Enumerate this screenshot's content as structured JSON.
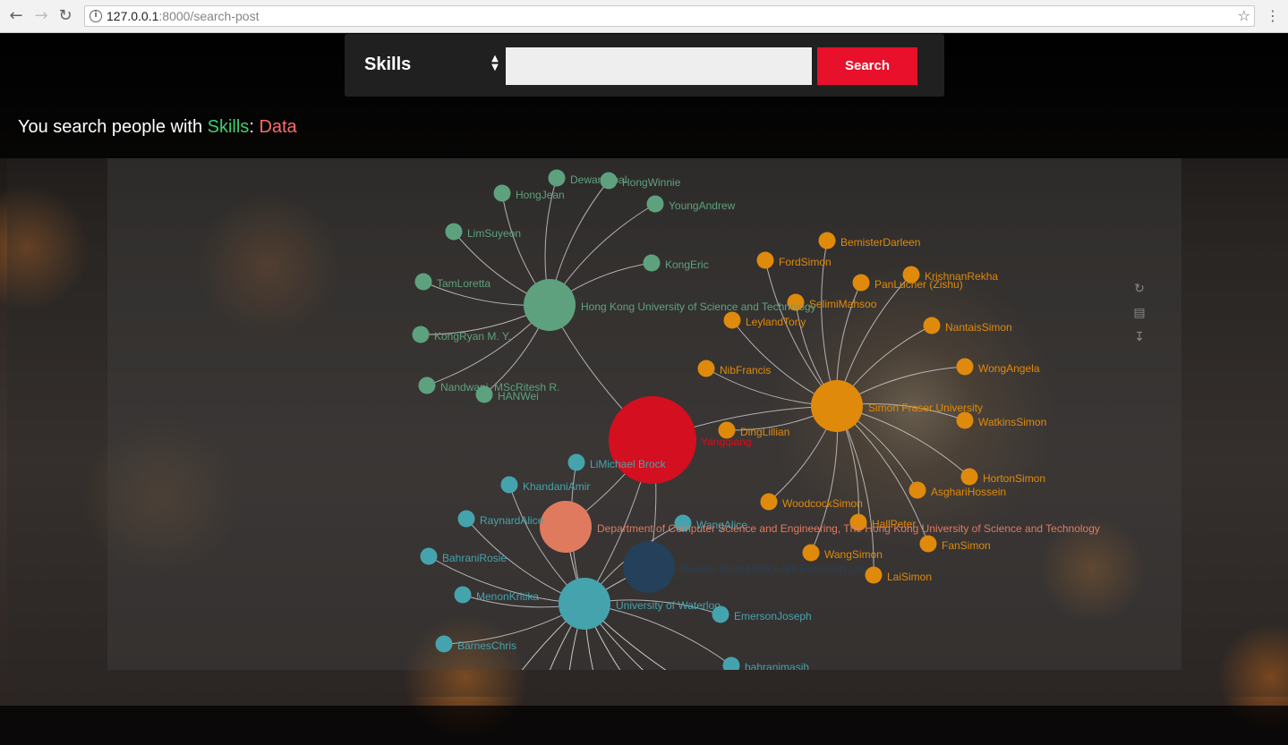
{
  "browser": {
    "url_host": "127.0.0.1",
    "url_rest": ":8000/search-post",
    "back_icon": "arrow-left-icon",
    "forward_icon": "arrow-right-icon",
    "reload_icon": "reload-icon"
  },
  "search": {
    "field_label": "Skills",
    "input_value": "",
    "button_label": "Search"
  },
  "result": {
    "prefix": "You search people with ",
    "keyword": "Skills",
    "separator": ": ",
    "value": "Data"
  },
  "colors": {
    "hkust": "#5ea17f",
    "sfu": "#e08a0b",
    "waterloo": "#45a3ad",
    "center": "#d40f1f",
    "dept": "#e07a5f",
    "huawei": "#25405a",
    "link": "#c9c9c9"
  },
  "graph": {
    "hubs": [
      {
        "id": "hkust",
        "label": "Hong Kong University of Science and Technology",
        "group": "hkust"
      },
      {
        "id": "sfu",
        "label": "Simon Fraser University",
        "group": "sfu"
      },
      {
        "id": "waterloo",
        "label": "University of Waterloo",
        "group": "waterloo"
      },
      {
        "id": "center",
        "label": "Yangqiang",
        "group": "center"
      },
      {
        "id": "dept",
        "label": "Department of Computer Science and Engineering, The Hong Kong University of Science and Technology",
        "group": "dept"
      },
      {
        "id": "huawei",
        "label": "Huawei Noah&#39;s Ark Research Lab",
        "group": "huawei"
      }
    ],
    "people": [
      {
        "label": "DewanIqbal",
        "hub": "hkust"
      },
      {
        "label": "HongWinnie",
        "hub": "hkust"
      },
      {
        "label": "HongJean",
        "hub": "hkust"
      },
      {
        "label": "YoungAndrew",
        "hub": "hkust"
      },
      {
        "label": "LimSuyeon",
        "hub": "hkust"
      },
      {
        "label": "KongEric",
        "hub": "hkust"
      },
      {
        "label": "TamLoretta",
        "hub": "hkust"
      },
      {
        "label": "KongRyan M. Y.",
        "hub": "hkust"
      },
      {
        "label": "Nandwani, MScRitesh R.",
        "hub": "hkust"
      },
      {
        "label": "HANWei",
        "hub": "hkust"
      },
      {
        "label": "BemisterDarleen",
        "hub": "sfu"
      },
      {
        "label": "FordSimon",
        "hub": "sfu"
      },
      {
        "label": "KrishnanRekha",
        "hub": "sfu"
      },
      {
        "label": "PanLucher (Zishu)",
        "hub": "sfu"
      },
      {
        "label": "SelimiMahsoo",
        "hub": "sfu"
      },
      {
        "label": "LeylandTony",
        "hub": "sfu"
      },
      {
        "label": "NantaisSimon",
        "hub": "sfu"
      },
      {
        "label": "NibFrancis",
        "hub": "sfu"
      },
      {
        "label": "WongAngela",
        "hub": "sfu"
      },
      {
        "label": "WatkinsSimon",
        "hub": "sfu"
      },
      {
        "label": "DingLillian",
        "hub": "sfu"
      },
      {
        "label": "HortonSimon",
        "hub": "sfu"
      },
      {
        "label": "AsghariHossein",
        "hub": "sfu"
      },
      {
        "label": "WoodcockSimon",
        "hub": "sfu"
      },
      {
        "label": "HallPeter",
        "hub": "sfu"
      },
      {
        "label": "FanSimon",
        "hub": "sfu"
      },
      {
        "label": "WangSimon",
        "hub": "sfu"
      },
      {
        "label": "LaiSimon",
        "hub": "sfu"
      },
      {
        "label": "LiMichael Brock",
        "hub": "waterloo"
      },
      {
        "label": "KhandaniAmir",
        "hub": "waterloo"
      },
      {
        "label": "RaynardAlice",
        "hub": "waterloo"
      },
      {
        "label": "WangAlice",
        "hub": "waterloo"
      },
      {
        "label": "BahraniRosie",
        "hub": "waterloo"
      },
      {
        "label": "MenonKritika",
        "hub": "waterloo"
      },
      {
        "label": "EmersonJoseph",
        "hub": "waterloo"
      },
      {
        "label": "BarnesChris",
        "hub": "waterloo"
      },
      {
        "label": "bahranimasih",
        "hub": "waterloo"
      }
    ]
  },
  "toolbox": {
    "restore_icon": "restore-icon",
    "dataview_icon": "data-view-icon",
    "save_icon": "save-image-icon"
  }
}
